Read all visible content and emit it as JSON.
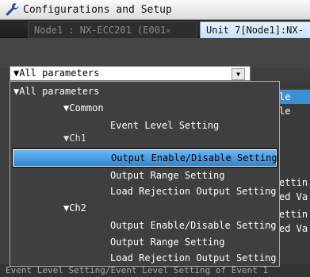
{
  "window": {
    "title": "Configurations and Setup",
    "icon": "wrench-icon"
  },
  "tabs": [
    {
      "label": "Node1 : NX-ECC201 (E001",
      "close": "×"
    },
    {
      "label": "Unit 7[Node1]:NX-"
    }
  ],
  "combo": {
    "value": "▼All parameters",
    "arrow": "▼"
  },
  "background_list": [
    {
      "text": "le",
      "highlighted": true
    },
    {
      "text": "le",
      "highlighted": false
    },
    {
      "text": "ettin",
      "highlighted": false
    },
    {
      "text": "ed Va",
      "highlighted": false
    },
    {
      "text": "ettin",
      "highlighted": false
    },
    {
      "text": "ed Va",
      "highlighted": false
    }
  ],
  "dropdown": {
    "items": [
      {
        "label": "▼All parameters",
        "level": 0
      },
      {
        "label": "▼Common",
        "level": 1
      },
      {
        "label": "Event Level Setting",
        "level": 2
      },
      {
        "label": "▼Ch1",
        "level": 1
      },
      {
        "label": "Output Enable/Disable Setting",
        "level": 2,
        "selected": true
      },
      {
        "label": "Output Range Setting",
        "level": 2
      },
      {
        "label": "Load Rejection Output Setting",
        "level": 2
      },
      {
        "label": "▼Ch2",
        "level": 1
      },
      {
        "label": "Output Enable/Disable Setting",
        "level": 2
      },
      {
        "label": "Output Range Setting",
        "level": 2
      },
      {
        "label": "Load Rejection Output Setting",
        "level": 2
      }
    ]
  },
  "status": {
    "text": "Event Level Setting/Event Level Setting of Event 1"
  },
  "colors": {
    "selection": "#3c8fd4",
    "dropdown_bg": "#3f3f3f",
    "window_bg": "#3e3e3e"
  }
}
